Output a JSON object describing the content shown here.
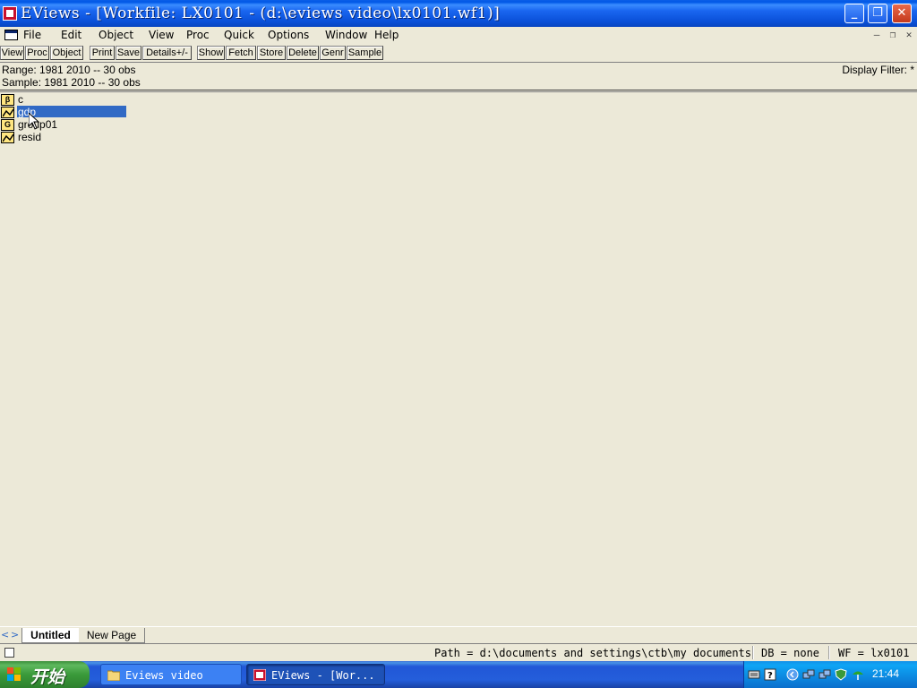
{
  "window": {
    "title": "EViews - [Workfile: LX0101 - (d:\\eviews video\\lx0101.wf1)]",
    "controls": {
      "minimize": "_",
      "maximize": "❐",
      "close": "✕"
    }
  },
  "menu": {
    "items": [
      "File",
      "Edit",
      "Object",
      "View",
      "Proc",
      "Quick",
      "Options",
      "Window",
      "Help"
    ],
    "mdi_controls": {
      "minimize": "–",
      "restore": "❐",
      "close": "✕"
    }
  },
  "toolbar": {
    "buttons": [
      "View",
      "Proc",
      "Object",
      "Print",
      "Save",
      "Details+/-",
      "Show",
      "Fetch",
      "Store",
      "Delete",
      "Genr",
      "Sample"
    ]
  },
  "workfile_info": {
    "range": "Range:  1981 2010  --  30 obs",
    "sample": "Sample: 1981 2010  --  30 obs",
    "display_filter": "Display Filter: *"
  },
  "objects": [
    {
      "name": "c",
      "type": "coefficient",
      "icon_letter": "β",
      "selected": false
    },
    {
      "name": "gdp",
      "type": "series",
      "icon_letter": "",
      "selected": true
    },
    {
      "name": "group01",
      "type": "group",
      "icon_letter": "G",
      "selected": false
    },
    {
      "name": "resid",
      "type": "series",
      "icon_letter": "",
      "selected": false
    }
  ],
  "page_tabs": {
    "active": "Untitled",
    "new_page": "New Page",
    "scroll_left": "<",
    "scroll_right": ">"
  },
  "status_bar": {
    "path": "Path = d:\\documents and settings\\ctb\\my documents",
    "db": "DB = none",
    "wf": "WF = lx0101"
  },
  "taskbar": {
    "start_label": "开始",
    "tasks": [
      {
        "label": "Eviews video",
        "active": false
      },
      {
        "label": "EViews - [Wor...",
        "active": true
      }
    ],
    "clock": "21:44"
  },
  "colors": {
    "selection": "#316ac5",
    "titlebar": "#0a5ee8",
    "object_icon": "#ffe680",
    "taskbar": "#245edb",
    "start_button": "#3a9a3a"
  }
}
